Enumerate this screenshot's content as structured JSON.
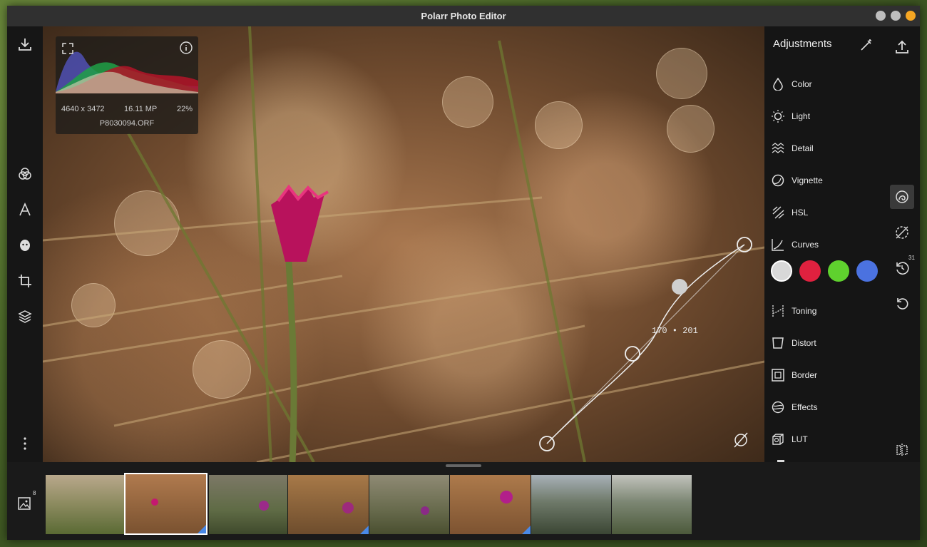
{
  "window": {
    "title": "Polarr Photo Editor",
    "controls": {
      "close": "#f5a623",
      "other": "#bbbbbb"
    }
  },
  "histogram": {
    "resolution": "4640 x 3472",
    "megapixels": "16.11 MP",
    "zoom": "22%",
    "filename": "P8030094.ORF"
  },
  "curve": {
    "readout": "170 • 201"
  },
  "adjustments": {
    "title": "Adjustments",
    "items": [
      {
        "label": "Color",
        "icon": "drop-icon"
      },
      {
        "label": "Light",
        "icon": "sun-icon"
      },
      {
        "label": "Detail",
        "icon": "waves-icon"
      },
      {
        "label": "Vignette",
        "icon": "vignette-icon"
      },
      {
        "label": "HSL",
        "icon": "hsl-icon"
      },
      {
        "label": "Curves",
        "icon": "curves-icon"
      },
      {
        "label": "Toning",
        "icon": "toning-icon"
      },
      {
        "label": "Distort",
        "icon": "distort-icon"
      },
      {
        "label": "Border",
        "icon": "border-icon"
      },
      {
        "label": "Effects",
        "icon": "effects-icon"
      },
      {
        "label": "LUT",
        "icon": "lut-icon"
      }
    ],
    "curve_channels": [
      {
        "name": "rgb",
        "color": "#d8d8d8"
      },
      {
        "name": "red",
        "color": "#e0213f"
      },
      {
        "name": "green",
        "color": "#5fd12e"
      },
      {
        "name": "blue",
        "color": "#4b72e0"
      }
    ]
  },
  "tools": {
    "history_count": "31"
  },
  "library": {
    "count": "8"
  }
}
